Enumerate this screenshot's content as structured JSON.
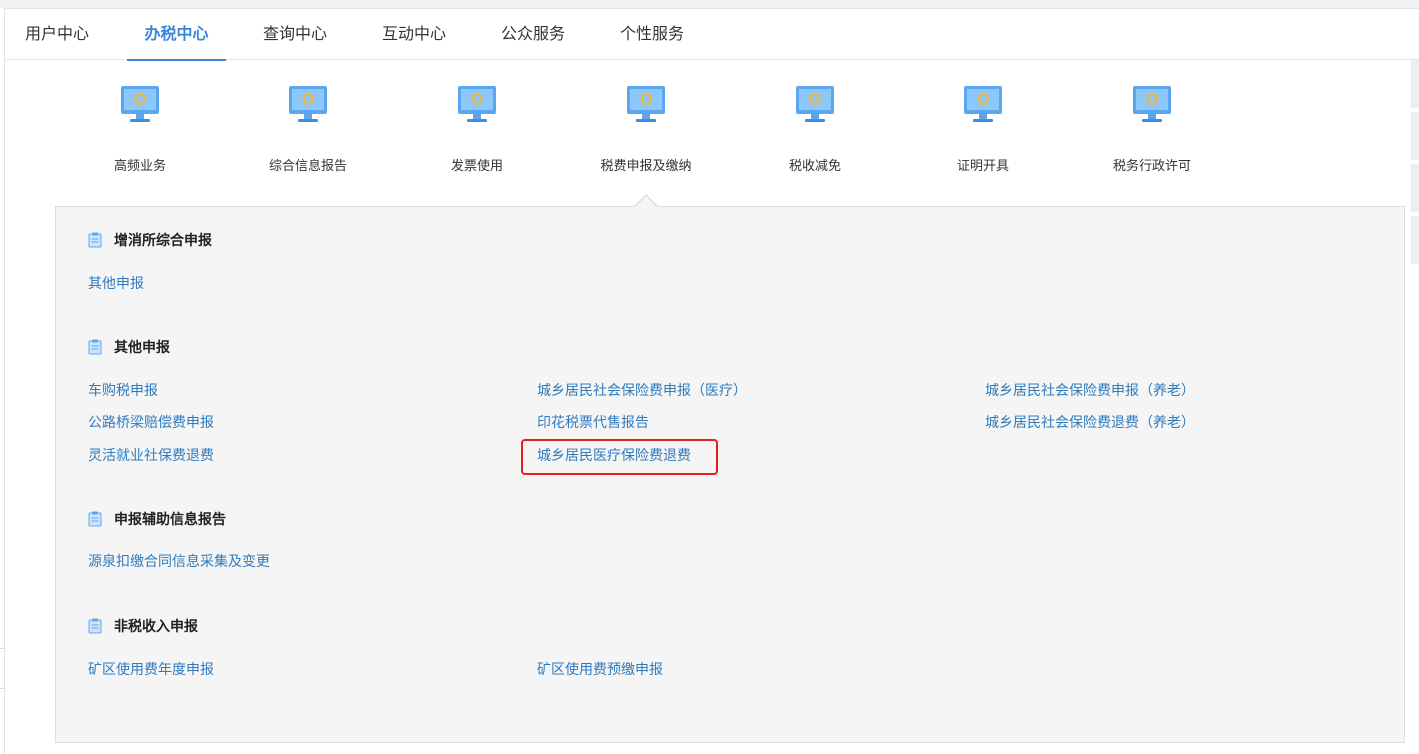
{
  "nav": {
    "tabs": [
      {
        "label": "用户中心"
      },
      {
        "label": "办税中心"
      },
      {
        "label": "查询中心"
      },
      {
        "label": "互动中心"
      },
      {
        "label": "公众服务"
      },
      {
        "label": "个性服务"
      }
    ],
    "active_tab": "办税中心"
  },
  "categories": [
    {
      "label": "高频业务",
      "icon": "monitor-icon"
    },
    {
      "label": "综合信息报告",
      "icon": "monitor-icon"
    },
    {
      "label": "发票使用",
      "icon": "monitor-icon"
    },
    {
      "label": "税费申报及缴纳",
      "icon": "monitor-icon"
    },
    {
      "label": "税收减免",
      "icon": "monitor-icon"
    },
    {
      "label": "证明开具",
      "icon": "monitor-icon"
    },
    {
      "label": "税务行政许可",
      "icon": "monitor-icon"
    }
  ],
  "selected_category": "税费申报及缴纳",
  "sections": [
    {
      "title": "增消所综合申报",
      "links": [
        "其他申报"
      ]
    },
    {
      "title": "其他申报",
      "links": [
        "车购税申报",
        "城乡居民社会保险费申报（医疗）",
        "城乡居民社会保险费申报（养老）",
        "公路桥梁赔偿费申报",
        "印花税票代售报告",
        "城乡居民社会保险费退费（养老）",
        "灵活就业社保费退费",
        "城乡居民医疗保险费退费"
      ]
    },
    {
      "title": "申报辅助信息报告",
      "links": [
        "源泉扣缴合同信息采集及变更"
      ]
    },
    {
      "title": "非税收入申报",
      "links": [
        "矿区使用费年度申报",
        "矿区使用费预缴申报"
      ]
    }
  ],
  "highlighted_link": "城乡居民医疗保险费退费",
  "colors": {
    "accent": "#3a86d8",
    "link": "#2f7bc0",
    "highlight": "#e5201b",
    "panel_bg": "#f5f5f5"
  }
}
